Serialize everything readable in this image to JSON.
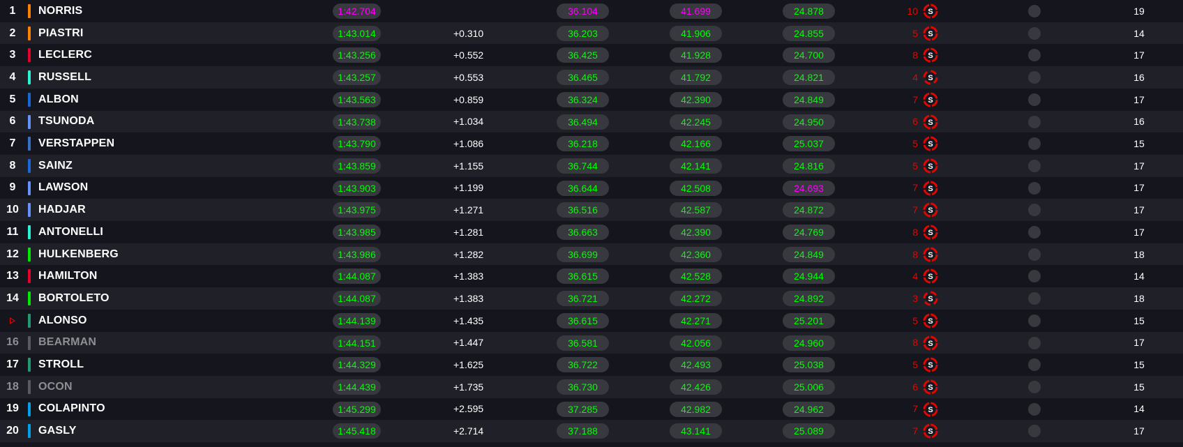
{
  "colors": {
    "row_odd": "#15151e",
    "row_even": "#202029",
    "personal_best": "#00ff00",
    "overall_best": "#ff00ff",
    "laps_text": "#e10600",
    "soft_tyre": "#e10600"
  },
  "tyre_compound_label": "S",
  "drivers": [
    {
      "pos": "1",
      "pos_dim": false,
      "pos_icon": "",
      "team_color": "#ff8000",
      "name": "NORRIS",
      "name_dim": false,
      "lap": "1:42.704",
      "lap_color": "purple",
      "gap": "",
      "s1": "36.104",
      "s1_color": "purple",
      "s2": "41.699",
      "s2_color": "purple",
      "s3": "24.878",
      "s3_color": "green",
      "tyre_laps": "10",
      "tyre": "soft-tyre-icon",
      "tyre_new": true,
      "pits": "19"
    },
    {
      "pos": "2",
      "pos_dim": false,
      "pos_icon": "",
      "team_color": "#ff8000",
      "name": "PIASTRI",
      "name_dim": false,
      "lap": "1:43.014",
      "lap_color": "green",
      "gap": "+0.310",
      "s1": "36.203",
      "s1_color": "green",
      "s2": "41.906",
      "s2_color": "green",
      "s3": "24.855",
      "s3_color": "green",
      "tyre_laps": "5",
      "tyre": "soft-tyre-icon",
      "tyre_new": true,
      "pits": "14"
    },
    {
      "pos": "3",
      "pos_dim": false,
      "pos_icon": "",
      "team_color": "#e8002d",
      "name": "LECLERC",
      "name_dim": false,
      "lap": "1:43.256",
      "lap_color": "green",
      "gap": "+0.552",
      "s1": "36.425",
      "s1_color": "green",
      "s2": "41.928",
      "s2_color": "green",
      "s3": "24.700",
      "s3_color": "green",
      "tyre_laps": "8",
      "tyre": "soft-tyre-icon",
      "tyre_new": true,
      "pits": "17"
    },
    {
      "pos": "4",
      "pos_dim": false,
      "pos_icon": "",
      "team_color": "#27f4d2",
      "name": "RUSSELL",
      "name_dim": false,
      "lap": "1:43.257",
      "lap_color": "green",
      "gap": "+0.553",
      "s1": "36.465",
      "s1_color": "green",
      "s2": "41.792",
      "s2_color": "green",
      "s3": "24.821",
      "s3_color": "green",
      "tyre_laps": "4",
      "tyre": "soft-tyre-icon",
      "tyre_new": false,
      "pits": "16"
    },
    {
      "pos": "5",
      "pos_dim": false,
      "pos_icon": "",
      "team_color": "#1868db",
      "name": "ALBON",
      "name_dim": false,
      "lap": "1:43.563",
      "lap_color": "green",
      "gap": "+0.859",
      "s1": "36.324",
      "s1_color": "green",
      "s2": "42.390",
      "s2_color": "green",
      "s3": "24.849",
      "s3_color": "green",
      "tyre_laps": "7",
      "tyre": "soft-tyre-icon",
      "tyre_new": true,
      "pits": "17"
    },
    {
      "pos": "6",
      "pos_dim": false,
      "pos_icon": "",
      "team_color": "#6692ff",
      "name": "TSUNODA",
      "name_dim": false,
      "lap": "1:43.738",
      "lap_color": "green",
      "gap": "+1.034",
      "s1": "36.494",
      "s1_color": "green",
      "s2": "42.245",
      "s2_color": "green",
      "s3": "24.950",
      "s3_color": "green",
      "tyre_laps": "6",
      "tyre": "soft-tyre-icon",
      "tyre_new": true,
      "pits": "16"
    },
    {
      "pos": "7",
      "pos_dim": false,
      "pos_icon": "",
      "team_color": "#3671c6",
      "name": "VERSTAPPEN",
      "name_dim": false,
      "lap": "1:43.790",
      "lap_color": "green",
      "gap": "+1.086",
      "s1": "36.218",
      "s1_color": "green",
      "s2": "42.166",
      "s2_color": "green",
      "s3": "25.037",
      "s3_color": "green",
      "tyre_laps": "5",
      "tyre": "soft-tyre-icon",
      "tyre_new": true,
      "pits": "15"
    },
    {
      "pos": "8",
      "pos_dim": false,
      "pos_icon": "",
      "team_color": "#1868db",
      "name": "SAINZ",
      "name_dim": false,
      "lap": "1:43.859",
      "lap_color": "green",
      "gap": "+1.155",
      "s1": "36.744",
      "s1_color": "green",
      "s2": "42.141",
      "s2_color": "green",
      "s3": "24.816",
      "s3_color": "green",
      "tyre_laps": "5",
      "tyre": "soft-tyre-icon",
      "tyre_new": true,
      "pits": "17"
    },
    {
      "pos": "9",
      "pos_dim": false,
      "pos_icon": "",
      "team_color": "#6692ff",
      "name": "LAWSON",
      "name_dim": false,
      "lap": "1:43.903",
      "lap_color": "green",
      "gap": "+1.199",
      "s1": "36.644",
      "s1_color": "green",
      "s2": "42.508",
      "s2_color": "green",
      "s3": "24.693",
      "s3_color": "purple",
      "tyre_laps": "7",
      "tyre": "soft-tyre-icon",
      "tyre_new": true,
      "pits": "17"
    },
    {
      "pos": "10",
      "pos_dim": false,
      "pos_icon": "",
      "team_color": "#6692ff",
      "name": "HADJAR",
      "name_dim": false,
      "lap": "1:43.975",
      "lap_color": "green",
      "gap": "+1.271",
      "s1": "36.516",
      "s1_color": "green",
      "s2": "42.587",
      "s2_color": "green",
      "s3": "24.872",
      "s3_color": "green",
      "tyre_laps": "7",
      "tyre": "soft-tyre-icon",
      "tyre_new": true,
      "pits": "17"
    },
    {
      "pos": "11",
      "pos_dim": false,
      "pos_icon": "",
      "team_color": "#27f4d2",
      "name": "ANTONELLI",
      "name_dim": false,
      "lap": "1:43.985",
      "lap_color": "green",
      "gap": "+1.281",
      "s1": "36.663",
      "s1_color": "green",
      "s2": "42.390",
      "s2_color": "green",
      "s3": "24.769",
      "s3_color": "green",
      "tyre_laps": "8",
      "tyre": "soft-tyre-icon",
      "tyre_new": true,
      "pits": "17"
    },
    {
      "pos": "12",
      "pos_dim": false,
      "pos_icon": "",
      "team_color": "#00e700",
      "name": "HULKENBERG",
      "name_dim": false,
      "lap": "1:43.986",
      "lap_color": "green",
      "gap": "+1.282",
      "s1": "36.699",
      "s1_color": "green",
      "s2": "42.360",
      "s2_color": "green",
      "s3": "24.849",
      "s3_color": "green",
      "tyre_laps": "8",
      "tyre": "soft-tyre-icon",
      "tyre_new": true,
      "pits": "18"
    },
    {
      "pos": "13",
      "pos_dim": false,
      "pos_icon": "",
      "team_color": "#e8002d",
      "name": "HAMILTON",
      "name_dim": false,
      "lap": "1:44.087",
      "lap_color": "green",
      "gap": "+1.383",
      "s1": "36.615",
      "s1_color": "green",
      "s2": "42.528",
      "s2_color": "green",
      "s3": "24.944",
      "s3_color": "green",
      "tyre_laps": "4",
      "tyre": "soft-tyre-icon",
      "tyre_new": true,
      "pits": "14"
    },
    {
      "pos": "14",
      "pos_dim": false,
      "pos_icon": "",
      "team_color": "#00e700",
      "name": "BORTOLETO",
      "name_dim": false,
      "lap": "1:44.087",
      "lap_color": "green",
      "gap": "+1.383",
      "s1": "36.721",
      "s1_color": "green",
      "s2": "42.272",
      "s2_color": "green",
      "s3": "24.892",
      "s3_color": "green",
      "tyre_laps": "3",
      "tyre": "soft-tyre-icon",
      "tyre_new": false,
      "pits": "18"
    },
    {
      "pos": "",
      "pos_dim": false,
      "pos_icon": "arrow-right-icon",
      "team_color": "#229971",
      "name": "ALONSO",
      "name_dim": false,
      "lap": "1:44.139",
      "lap_color": "green",
      "gap": "+1.435",
      "s1": "36.615",
      "s1_color": "green",
      "s2": "42.271",
      "s2_color": "green",
      "s3": "25.201",
      "s3_color": "green",
      "tyre_laps": "5",
      "tyre": "soft-tyre-icon",
      "tyre_new": true,
      "pits": "15"
    },
    {
      "pos": "16",
      "pos_dim": true,
      "pos_icon": "",
      "team_color": "#5a5a5f",
      "name": "BEARMAN",
      "name_dim": true,
      "lap": "1:44.151",
      "lap_color": "green",
      "gap": "+1.447",
      "s1": "36.581",
      "s1_color": "green",
      "s2": "42.056",
      "s2_color": "green",
      "s3": "24.960",
      "s3_color": "green",
      "tyre_laps": "8",
      "tyre": "soft-tyre-icon",
      "tyre_new": true,
      "pits": "17"
    },
    {
      "pos": "17",
      "pos_dim": false,
      "pos_icon": "",
      "team_color": "#229971",
      "name": "STROLL",
      "name_dim": false,
      "lap": "1:44.329",
      "lap_color": "green",
      "gap": "+1.625",
      "s1": "36.722",
      "s1_color": "green",
      "s2": "42.493",
      "s2_color": "green",
      "s3": "25.038",
      "s3_color": "green",
      "tyre_laps": "5",
      "tyre": "soft-tyre-icon",
      "tyre_new": true,
      "pits": "15"
    },
    {
      "pos": "18",
      "pos_dim": true,
      "pos_icon": "",
      "team_color": "#5a5a5f",
      "name": "OCON",
      "name_dim": true,
      "lap": "1:44.439",
      "lap_color": "green",
      "gap": "+1.735",
      "s1": "36.730",
      "s1_color": "green",
      "s2": "42.426",
      "s2_color": "green",
      "s3": "25.006",
      "s3_color": "green",
      "tyre_laps": "6",
      "tyre": "soft-tyre-icon",
      "tyre_new": true,
      "pits": "15"
    },
    {
      "pos": "19",
      "pos_dim": false,
      "pos_icon": "",
      "team_color": "#00a1e8",
      "name": "COLAPINTO",
      "name_dim": false,
      "lap": "1:45.299",
      "lap_color": "green",
      "gap": "+2.595",
      "s1": "37.285",
      "s1_color": "green",
      "s2": "42.982",
      "s2_color": "green",
      "s3": "24.962",
      "s3_color": "green",
      "tyre_laps": "7",
      "tyre": "soft-tyre-icon",
      "tyre_new": true,
      "pits": "14"
    },
    {
      "pos": "20",
      "pos_dim": false,
      "pos_icon": "",
      "team_color": "#00a1e8",
      "name": "GASLY",
      "name_dim": false,
      "lap": "1:45.418",
      "lap_color": "green",
      "gap": "+2.714",
      "s1": "37.188",
      "s1_color": "green",
      "s2": "43.141",
      "s2_color": "green",
      "s3": "25.089",
      "s3_color": "green",
      "tyre_laps": "7",
      "tyre": "soft-tyre-icon",
      "tyre_new": true,
      "pits": "17"
    }
  ]
}
